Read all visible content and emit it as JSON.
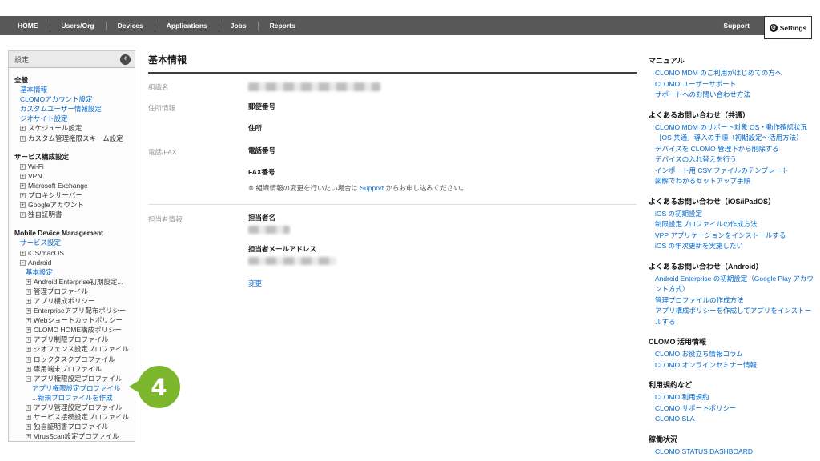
{
  "nav": {
    "items": [
      "HOME",
      "Users/Org",
      "Devices",
      "Applications",
      "Jobs",
      "Reports"
    ],
    "support": "Support",
    "settings": "Settings"
  },
  "icons": {
    "gear": "⚙",
    "collapse_panel": "‹",
    "tree_expand": "+",
    "tree_collapse": "-"
  },
  "sidebar": {
    "title": "設定",
    "items": [
      {
        "type": "header",
        "label": "全般"
      },
      {
        "type": "link",
        "level": 1,
        "label": "基本情報"
      },
      {
        "type": "link",
        "level": 1,
        "label": "CLOMOアカウント設定"
      },
      {
        "type": "link",
        "level": 1,
        "label": "カスタムユーザー情報設定"
      },
      {
        "type": "link",
        "level": 1,
        "label": "ジオサイト設定"
      },
      {
        "type": "tree",
        "level": 1,
        "label": "スケジュール設定"
      },
      {
        "type": "tree",
        "level": 1,
        "label": "カスタム管理権限スキーム設定"
      },
      {
        "type": "header",
        "label": "サービス構成設定",
        "gap": true
      },
      {
        "type": "tree",
        "level": 1,
        "label": "Wi-Fi"
      },
      {
        "type": "tree",
        "level": 1,
        "label": "VPN"
      },
      {
        "type": "tree",
        "level": 1,
        "label": "Microsoft Exchange"
      },
      {
        "type": "tree",
        "level": 1,
        "label": "プロキシサーバー"
      },
      {
        "type": "tree",
        "level": 1,
        "label": "Googleアカウント"
      },
      {
        "type": "tree",
        "level": 1,
        "label": "独自証明書"
      },
      {
        "type": "header",
        "label": "Mobile Device Management",
        "gap": true
      },
      {
        "type": "link",
        "level": 1,
        "label": "サービス設定"
      },
      {
        "type": "tree",
        "level": 1,
        "label": "iOS/macOS"
      },
      {
        "type": "tree_open",
        "level": 1,
        "label": "Android"
      },
      {
        "type": "link",
        "level": 2,
        "label": "基本設定"
      },
      {
        "type": "tree",
        "level": 2,
        "label": "Android Enterprise初期設定..."
      },
      {
        "type": "tree",
        "level": 2,
        "label": "管理プロファイル"
      },
      {
        "type": "tree",
        "level": 2,
        "label": "アプリ構成ポリシー"
      },
      {
        "type": "tree",
        "level": 2,
        "label": "Enterpriseアプリ配布ポリシー"
      },
      {
        "type": "tree",
        "level": 2,
        "label": "Webショートカットポリシー"
      },
      {
        "type": "tree",
        "level": 2,
        "label": "CLOMO HOME構成ポリシー"
      },
      {
        "type": "tree",
        "level": 2,
        "label": "アプリ制限プロファイル"
      },
      {
        "type": "tree",
        "level": 2,
        "label": "ジオフェンス設定プロファイル"
      },
      {
        "type": "tree",
        "level": 2,
        "label": "ロックタスクプロファイル"
      },
      {
        "type": "tree",
        "level": 2,
        "label": "専用端末プロファイル"
      },
      {
        "type": "tree_open",
        "level": 2,
        "label": "アプリ権限設定プロファイル"
      },
      {
        "type": "link",
        "level": 3,
        "label": "アプリ権限設定プロファイル"
      },
      {
        "type": "link",
        "level": 3,
        "label": "...新規プロファイルを作成"
      },
      {
        "type": "tree",
        "level": 2,
        "label": "アプリ管理設定プロファイル"
      },
      {
        "type": "tree",
        "level": 2,
        "label": "サービス接続設定プロファイル"
      },
      {
        "type": "tree",
        "level": 2,
        "label": "独自証明書プロファイル"
      },
      {
        "type": "tree",
        "level": 2,
        "label": "VirusScan設定プロファイル"
      }
    ]
  },
  "main": {
    "title": "基本情報",
    "org_name_label": "組織名",
    "address_label": "住所情報",
    "postal_label": "郵便番号",
    "street_label": "住所",
    "phone_fax_label": "電話/FAX",
    "phone_label": "電話番号",
    "fax_label": "FAX番号",
    "note_prefix": "※ 組織情報の変更を行いたい場合は ",
    "note_link": "Support",
    "note_suffix": " からお申し込みください。",
    "contact_label": "担当者情報",
    "contact_name_label": "担当者名",
    "contact_email_label": "担当者メールアドレス",
    "change_link": "変更"
  },
  "help": {
    "sections": [
      {
        "title": "マニュアル",
        "links": [
          "CLOMO MDM のご利用がはじめての方へ",
          "CLOMO ユーザーサポート",
          "サポートへのお問い合わせ方法"
        ]
      },
      {
        "title": "よくあるお問い合わせ（共通）",
        "links": [
          "CLOMO MDM のサポート対象 OS・動作確認状況",
          "［OS 共通］導入の手順（初期設定～活用方法）",
          "デバイスを CLOMO 管理下から削除する",
          "デバイスの入れ替えを行う",
          "インポート用 CSV ファイルのテンプレート",
          "図解でわかるセットアップ手順"
        ]
      },
      {
        "title": "よくあるお問い合わせ（iOS/iPadOS）",
        "links": [
          "iOS の初期設定",
          "制限設定プロファイルの作成方法",
          "VPP アプリケーションをインストールする",
          "iOS の年次更新を実施したい"
        ]
      },
      {
        "title": "よくあるお問い合わせ（Android）",
        "links": [
          "Android Enterprise の初期設定（Google Play アカウント方式）",
          "管理プロファイルの作成方法",
          "アプリ構成ポリシーを作成してアプリをインストールする"
        ]
      },
      {
        "title": "CLOMO 活用情報",
        "links": [
          "CLOMO お役立ち情報コラム",
          "CLOMO オンラインセミナー情報"
        ]
      },
      {
        "title": "利用規約など",
        "links": [
          "CLOMO 利用規約",
          "CLOMO サポートポリシー",
          "CLOMO SLA"
        ]
      },
      {
        "title": "稼働状況",
        "links": [
          "CLOMO STATUS DASHBOARD"
        ]
      }
    ]
  },
  "annotation": {
    "number": "4"
  },
  "colors": {
    "link_blue": "#0066cc",
    "nav_gray": "#58585a",
    "badge_green": "#7cb62c"
  }
}
